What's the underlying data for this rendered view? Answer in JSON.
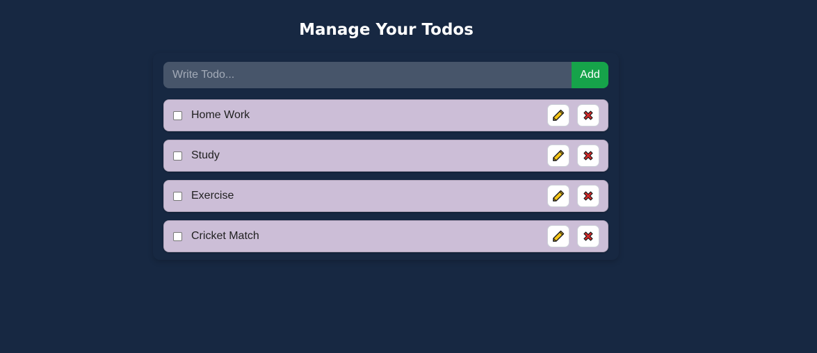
{
  "page": {
    "title": "Manage Your Todos"
  },
  "form": {
    "placeholder": "Write Todo...",
    "value": "",
    "add_label": "Add"
  },
  "todos": [
    {
      "text": "Home Work",
      "completed": false
    },
    {
      "text": "Study",
      "completed": false
    },
    {
      "text": "Exercise",
      "completed": false
    },
    {
      "text": "Cricket Match",
      "completed": false
    }
  ],
  "icons": {
    "edit": "pencil-icon",
    "delete": "cross-mark-icon"
  },
  "colors": {
    "background": "#172842",
    "input_bg": "#47556a",
    "add_button": "#16a34a",
    "todo_bg": "#ccbed7",
    "delete_red": "#d42a2a",
    "pencil_yellow": "#f5c518"
  }
}
